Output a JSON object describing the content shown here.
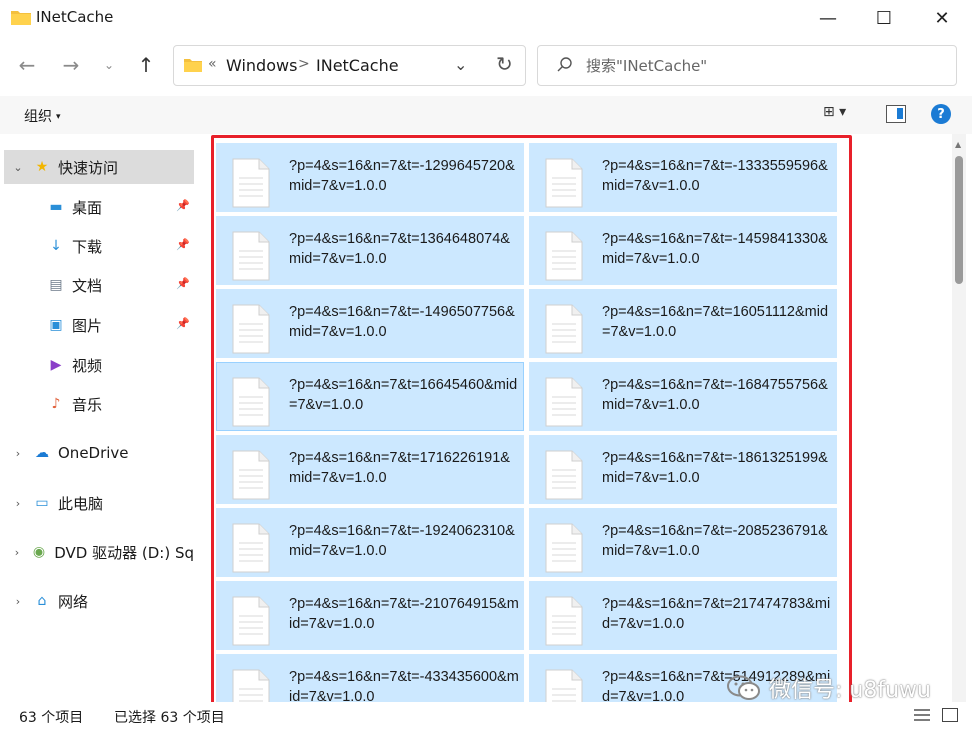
{
  "window": {
    "title": "INetCache",
    "min_glyph": "—",
    "max_glyph": "☐",
    "close_glyph": "✕"
  },
  "nav": {
    "back_glyph": "←",
    "forward_glyph": "→",
    "recent_glyph": "⌄",
    "up_glyph": "↑"
  },
  "address": {
    "overflow": "«",
    "crumbs": [
      "Windows",
      "INetCache"
    ],
    "separator": ">",
    "dropdown_glyph": "⌄",
    "refresh_glyph": "↻"
  },
  "search": {
    "placeholder": "搜索\"INetCache\""
  },
  "toolbar": {
    "organize_label": "组织",
    "organize_caret": "▾",
    "view_glyph": "⊞ ▾",
    "help_glyph": "?"
  },
  "sidebar": {
    "items": [
      {
        "label": "快速访问",
        "icon": "star-icon",
        "glyph": "★",
        "color": "#f2b600"
      },
      {
        "label": "桌面",
        "icon": "desktop-icon",
        "glyph": "▬",
        "color": "#2a8fd8"
      },
      {
        "label": "下载",
        "icon": "download-icon",
        "glyph": "↓",
        "color": "#2a8fd8"
      },
      {
        "label": "文档",
        "icon": "document-icon",
        "glyph": "▤",
        "color": "#6d7a8a"
      },
      {
        "label": "图片",
        "icon": "pictures-icon",
        "glyph": "▣",
        "color": "#2a8fd8"
      },
      {
        "label": "视频",
        "icon": "videos-icon",
        "glyph": "▶",
        "color": "#8a3fc8"
      },
      {
        "label": "音乐",
        "icon": "music-icon",
        "glyph": "♪",
        "color": "#e0603a"
      },
      {
        "label": "OneDrive",
        "icon": "cloud-icon",
        "glyph": "☁",
        "color": "#1b7bd4"
      },
      {
        "label": "此电脑",
        "icon": "computer-icon",
        "glyph": "▭",
        "color": "#2a8fd8"
      },
      {
        "label": "DVD 驱动器 (D:) Sq",
        "icon": "dvd-drive-icon",
        "glyph": "◉",
        "color": "#6aa84f"
      },
      {
        "label": "网络",
        "icon": "network-icon",
        "glyph": "⌂",
        "color": "#2a8fd8"
      }
    ],
    "pin_glyph": "📌",
    "chevron_down": "⌄",
    "chevron_right": "›"
  },
  "files": [
    "?p=4&s=16&n=7&t=-1299645720&mid=7&v=1.0.0",
    "?p=4&s=16&n=7&t=-1333559596&mid=7&v=1.0.0",
    "?p=4&s=16&n=7&t=1364648074&mid=7&v=1.0.0",
    "?p=4&s=16&n=7&t=-1459841330&mid=7&v=1.0.0",
    "?p=4&s=16&n=7&t=-1496507756&mid=7&v=1.0.0",
    "?p=4&s=16&n=7&t=16051112&mid=7&v=1.0.0",
    "?p=4&s=16&n=7&t=16645460&mid=7&v=1.0.0",
    "?p=4&s=16&n=7&t=-1684755756&mid=7&v=1.0.0",
    "?p=4&s=16&n=7&t=1716226191&mid=7&v=1.0.0",
    "?p=4&s=16&n=7&t=-1861325199&mid=7&v=1.0.0",
    "?p=4&s=16&n=7&t=-1924062310&mid=7&v=1.0.0",
    "?p=4&s=16&n=7&t=-2085236791&mid=7&v=1.0.0",
    "?p=4&s=16&n=7&t=-210764915&mid=7&v=1.0.0",
    "?p=4&s=16&n=7&t=217474783&mid=7&v=1.0.0",
    "?p=4&s=16&n=7&t=-433435600&mid=7&v=1.0.0",
    "?p=4&s=16&n=7&t=514912289&mid=7&v=1.0.0"
  ],
  "status": {
    "item_count": "63 个项目",
    "selected_count": "已选择 63 个项目"
  },
  "watermark": {
    "text": "微信号: u8fuwu"
  },
  "colors": {
    "selection": "#cce8ff",
    "selection_border": "#99d1ff",
    "highlight_box": "#e8202a",
    "accent": "#1b7bd4"
  }
}
